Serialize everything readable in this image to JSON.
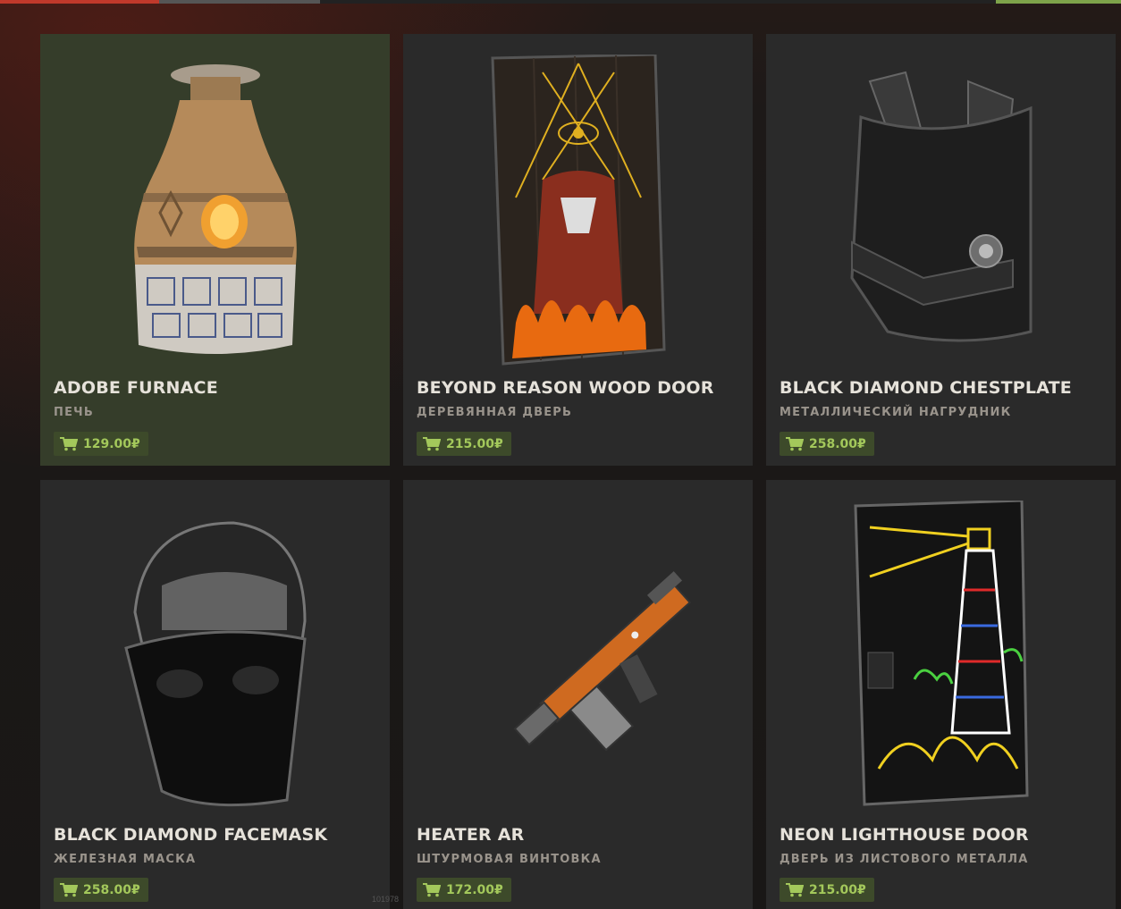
{
  "items": [
    {
      "name": "ADOBE FURNACE",
      "subtitle": "ПЕЧЬ",
      "price": "129.00₽",
      "icon": "furnace-icon"
    },
    {
      "name": "BEYOND REASON WOOD DOOR",
      "subtitle": "ДЕРЕВЯННАЯ ДВЕРЬ",
      "price": "215.00₽",
      "icon": "wood-door-icon"
    },
    {
      "name": "BLACK DIAMOND CHESTPLATE",
      "subtitle": "МЕТАЛЛИЧЕСКИЙ НАГРУДНИК",
      "price": "258.00₽",
      "icon": "chestplate-icon"
    },
    {
      "name": "BLACK DIAMOND FACEMASK",
      "subtitle": "ЖЕЛЕЗНАЯ МАСКА",
      "price": "258.00₽",
      "icon": "facemask-icon"
    },
    {
      "name": "HEATER AR",
      "subtitle": "ШТУРМОВАЯ ВИНТОВКА",
      "price": "172.00₽",
      "icon": "rifle-icon"
    },
    {
      "name": "NEON LIGHTHOUSE DOOR",
      "subtitle": "ДВЕРЬ ИЗ ЛИСТОВОГО МЕТАЛЛА",
      "price": "215.00₽",
      "icon": "sheet-metal-door-icon"
    }
  ],
  "footer_number": "101978",
  "colors": {
    "active_card_bg": "#353d2a",
    "card_bg": "#2a2a2a",
    "price_text": "#a3c85b",
    "price_bg": "#3d4a2a"
  }
}
